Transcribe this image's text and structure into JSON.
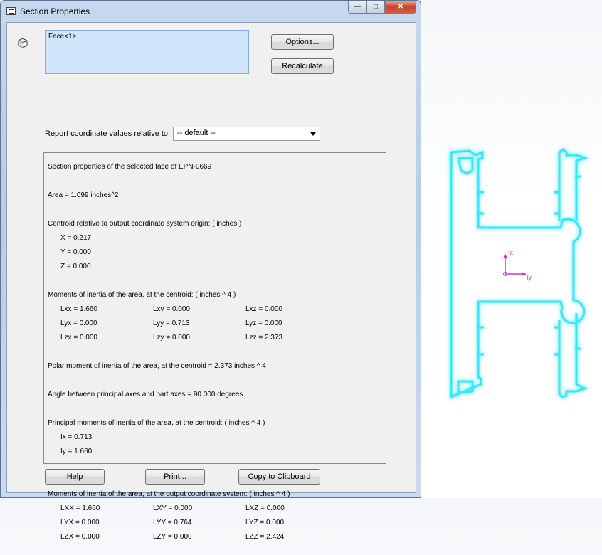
{
  "window": {
    "title": "Section Properties"
  },
  "selection": {
    "items": [
      "Face<1>"
    ]
  },
  "buttons": {
    "options": "Options...",
    "recalculate": "Recalculate",
    "help": "Help",
    "print": "Print...",
    "copy": "Copy to Clipboard"
  },
  "report": {
    "label": "Report coordinate values relative to:",
    "value": "-- default --"
  },
  "results": {
    "header": "Section properties of the selected face of EPN-0669",
    "area": "Area = 1.099 inches^2",
    "centroid_title": "Centroid relative to output coordinate system origin: ( inches )",
    "centroid": [
      "X = 0.217",
      "Y = 0.000",
      "Z = 0.000"
    ],
    "moi_centroid_title": "Moments of inertia of the area, at the centroid: ( inches ^ 4 )",
    "moi_centroid": [
      [
        "Lxx = 1.660",
        "Lxy = 0.000",
        "Lxz = 0.000"
      ],
      [
        "Lyx = 0.000",
        "Lyy = 0.713",
        "Lyz = 0.000"
      ],
      [
        "Lzx = 0.000",
        "Lzy = 0.000",
        "Lzz = 2.373"
      ]
    ],
    "polar": "Polar moment of inertia of the area, at the centroid = 2.373 inches ^ 4",
    "angle": "Angle between principal axes and part axes = 90.000 degrees",
    "principal_title": "Principal moments of inertia of the area, at the centroid: ( inches ^ 4 )",
    "principal": [
      "Ix = 0.713",
      "Iy = 1.660"
    ],
    "moi_output_title": "Moments of inertia of the area, at the output coordinate system: ( inches ^ 4 )",
    "moi_output": [
      [
        "LXX = 1.660",
        "LXY = 0.000",
        "LXZ = 0.000"
      ],
      [
        "LYX = 0.000",
        "LYY = 0.764",
        "LYZ = 0.000"
      ],
      [
        "LZX = 0.000",
        "LZY = 0.000",
        "LZZ = 2.424"
      ]
    ]
  },
  "graphics": {
    "axis_x_label": "Ix",
    "axis_y_label": "Iy",
    "outline_color": "#38e6f5",
    "axis_color": "#c23bd0"
  }
}
